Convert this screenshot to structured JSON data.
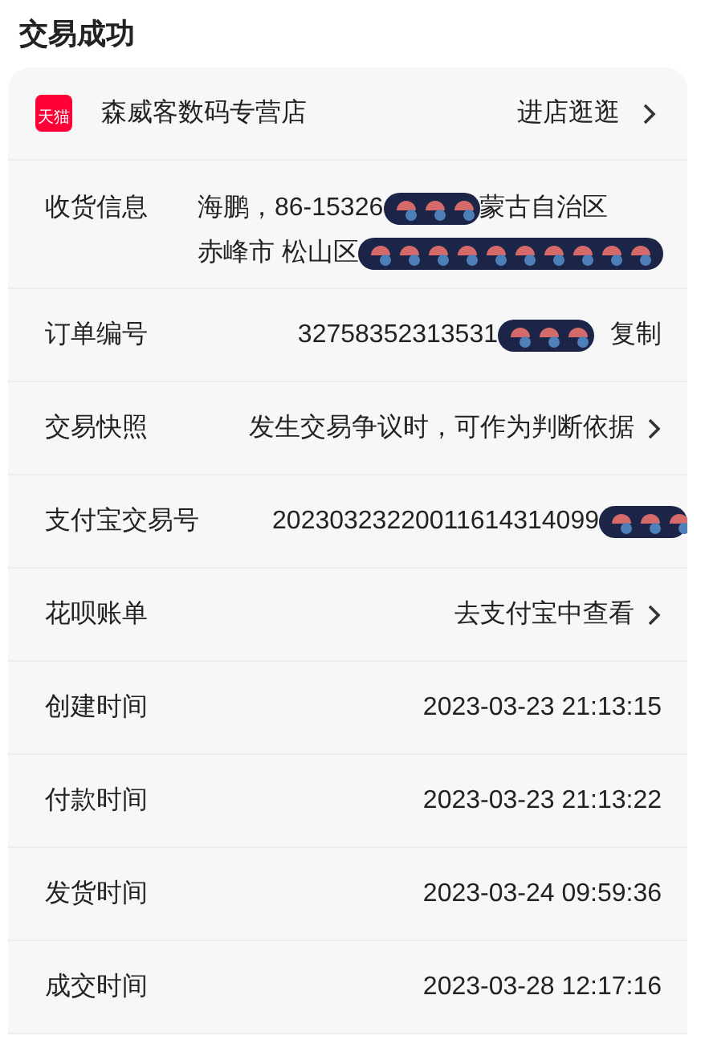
{
  "title": "交易成功",
  "shop": {
    "badge": "天猫",
    "name": "森威客数码专营店",
    "action": "进店逛逛"
  },
  "rows": [
    {
      "kind": "multiline",
      "label": "收货信息",
      "lines": [
        [
          {
            "kind": "text",
            "text": "海鹏，86-15326"
          },
          {
            "kind": "redaction"
          },
          {
            "kind": "text",
            "text": "蒙古自治区"
          }
        ],
        [
          {
            "kind": "text",
            "text": "赤峰市 松山区"
          },
          {
            "kind": "redaction"
          }
        ]
      ]
    },
    {
      "kind": "copy",
      "label": "订单编号",
      "segments": [
        {
          "kind": "text",
          "text": "32758352313531"
        },
        {
          "kind": "redaction"
        }
      ],
      "action": "复制"
    },
    {
      "kind": "link",
      "label": "交易快照",
      "segments": [
        {
          "kind": "text",
          "text": "发生交易争议时，可作为判断依据"
        }
      ]
    },
    {
      "kind": "plain",
      "label": "支付宝交易号",
      "segments": [
        {
          "kind": "text",
          "text": "20230323220011614314099"
        },
        {
          "kind": "redaction"
        }
      ]
    },
    {
      "kind": "link",
      "label": "花呗账单",
      "segments": [
        {
          "kind": "text",
          "text": "去支付宝中查看"
        }
      ]
    },
    {
      "kind": "plain",
      "label": "创建时间",
      "segments": [
        {
          "kind": "text",
          "text": "2023-03-23 21:13:15"
        }
      ]
    },
    {
      "kind": "plain",
      "label": "付款时间",
      "segments": [
        {
          "kind": "text",
          "text": "2023-03-23 21:13:22"
        }
      ]
    },
    {
      "kind": "plain",
      "label": "发货时间",
      "segments": [
        {
          "kind": "text",
          "text": "2023-03-24 09:59:36"
        }
      ]
    },
    {
      "kind": "plain",
      "label": "成交时间",
      "segments": [
        {
          "kind": "text",
          "text": "2023-03-28 12:17:16"
        }
      ]
    }
  ]
}
